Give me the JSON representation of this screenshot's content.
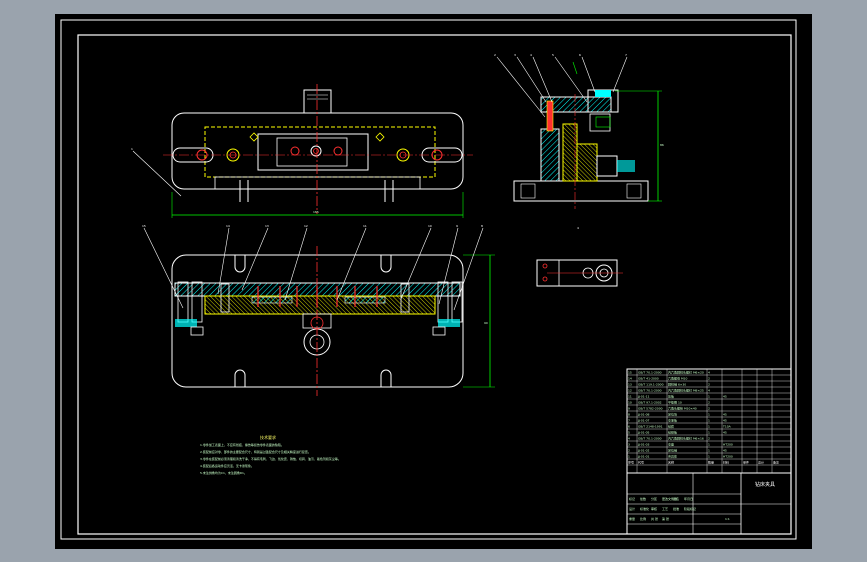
{
  "drawing": {
    "front_view": {
      "leader_labels": [
        "1"
      ],
      "dimension": "185"
    },
    "side_view": {
      "leader_labels": [
        "2",
        "3",
        "4",
        "5",
        "6",
        "7"
      ],
      "dimension": "86"
    },
    "plan_view": {
      "leader_labels": [
        "15",
        "14",
        "13",
        "12",
        "11",
        "10",
        "9",
        "8"
      ],
      "dimension": "90"
    },
    "detail_view": {
      "label": "4"
    },
    "tech_req": {
      "title": "技术要求",
      "lines": [
        "1.零件加工表面上，不应有划痕、擦伤等损伤零件表面的缺陷。",
        "2.装配前应对零、部件的主要配合尺寸，特别是过盈配合尺寸及相关精度进行复查。",
        "3.零件在装配前必须清理和清洗干净，不得有毛刺、飞边、氧化皮、锈蚀、切屑、油污、着色剂和灰尘等。",
        "4.装配后各运动件应灵活，无卡滞现象。",
        "5.未注倒角均为C1，未注圆角R1。"
      ]
    },
    "bom_rows": [
      [
        "15",
        "GB/T 70.1-2000",
        "内六角圆柱头螺钉 M6×20",
        "4",
        "",
        "",
        "",
        ""
      ],
      [
        "14",
        "GB/T 41-2000",
        "六角螺母 M10",
        "2",
        "",
        "",
        "",
        ""
      ],
      [
        "13",
        "GB/T 119.1-2000",
        "圆柱销 6×30",
        "2",
        "",
        "",
        "",
        ""
      ],
      [
        "12",
        "GB/T 70.1-2000",
        "内六角圆柱头螺钉 M8×25",
        "4",
        "",
        "",
        "",
        ""
      ],
      [
        "11",
        "JJ-01-11",
        "压板",
        "1",
        "45",
        "",
        "",
        ""
      ],
      [
        "10",
        "GB/T 97.1-2002",
        "平垫圈 10",
        "2",
        "",
        "",
        "",
        ""
      ],
      [
        "9",
        "GB/T 5782-2000",
        "六角头螺栓 M10×40",
        "2",
        "",
        "",
        "",
        ""
      ],
      [
        "8",
        "JJ-01-08",
        "定位块",
        "1",
        "45",
        "",
        "",
        ""
      ],
      [
        "7",
        "JJ-01-07",
        "支承板",
        "1",
        "45",
        "",
        "",
        ""
      ],
      [
        "6",
        "GB/T 2148-1991",
        "钻套",
        "1",
        "T10A",
        "",
        "",
        ""
      ],
      [
        "5",
        "JJ-01-05",
        "钻模板",
        "1",
        "45",
        "",
        "",
        ""
      ],
      [
        "4",
        "GB/T 70.1-2000",
        "内六角圆柱头螺钉 M6×16",
        "2",
        "",
        "",
        "",
        ""
      ],
      [
        "3",
        "JJ-01-03",
        "支座",
        "1",
        "HT200",
        "",
        "",
        ""
      ],
      [
        "2",
        "JJ-01-02",
        "定位销",
        "1",
        "45",
        "",
        "",
        ""
      ],
      [
        "1",
        "JJ-01-01",
        "夹具体",
        "1",
        "HT200",
        "",
        "",
        ""
      ]
    ],
    "bom_header": [
      "序号",
      "代号",
      "名称",
      "数量",
      "材料",
      "单件",
      "总计",
      "备注"
    ],
    "title_block": {
      "name": "钻床夹具",
      "cells": [
        "标记",
        "处数",
        "分区",
        "更改文件号",
        "签名",
        "年月日",
        "设计",
        "标准化",
        "审核",
        "工艺",
        "批准",
        "阶段标记",
        "重量",
        "比例",
        "共 张",
        "第 张"
      ],
      "scale": "1:1"
    },
    "colors": {
      "background": "#000000",
      "border": "#ffffff",
      "centerline": "#ff3030",
      "part": "#ffff00",
      "hatch": "#00ffff",
      "dimension": "#00ff00",
      "leader": "#ffffff",
      "window": "#9aa3ad"
    }
  }
}
